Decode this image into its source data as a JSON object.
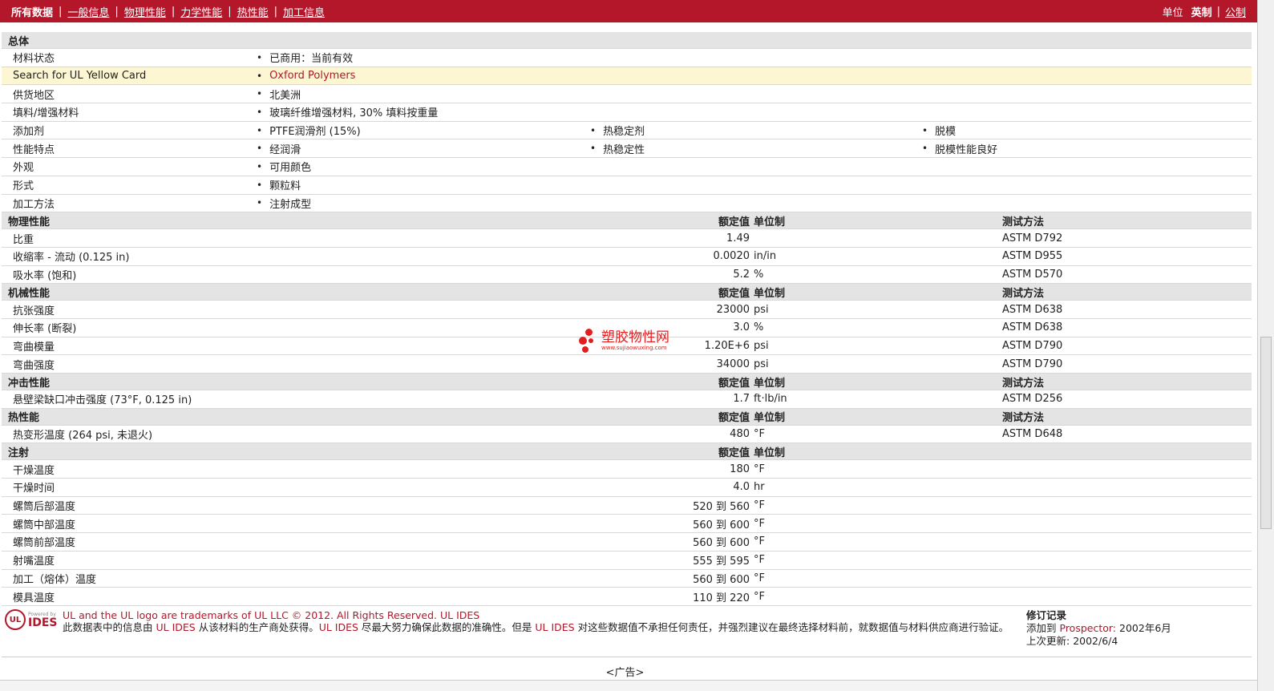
{
  "nav": {
    "items": [
      "所有数据",
      "一般信息",
      "物理性能",
      "力学性能",
      "热性能",
      "加工信息"
    ],
    "units_label": "单位",
    "units_current": "英制",
    "units_other": "公制"
  },
  "general": {
    "title": "总体",
    "rows": [
      {
        "label": "材料状态",
        "values": [
          "已商用：当前有效"
        ]
      },
      {
        "label": "Search for UL Yellow Card",
        "values": [
          "Oxford Polymers"
        ]
      },
      {
        "label": "供货地区",
        "values": [
          "北美洲"
        ]
      },
      {
        "label": "填料/增强材料",
        "values": [
          "玻璃纤维增强材料, 30% 填料按重量"
        ]
      },
      {
        "label": "添加剂",
        "values": [
          "PTFE润滑剂 (15%)",
          "热稳定剂",
          "脱模"
        ]
      },
      {
        "label": "性能特点",
        "values": [
          "经润滑",
          "热稳定性",
          "脱模性能良好"
        ]
      },
      {
        "label": "外观",
        "values": [
          "可用颜色"
        ]
      },
      {
        "label": "形式",
        "values": [
          "颗粒料"
        ]
      },
      {
        "label": "加工方法",
        "values": [
          "注射成型"
        ]
      }
    ]
  },
  "headers": {
    "nominal": "额定值",
    "unit": "单位制",
    "test": "测试方法"
  },
  "physical": {
    "title": "物理性能",
    "rows": [
      {
        "label": "比重",
        "value": "1.49",
        "unit": "",
        "test": "ASTM D792"
      },
      {
        "label": "收缩率 - 流动 (0.125 in)",
        "value": "0.0020",
        "unit": "in/in",
        "test": "ASTM D955"
      },
      {
        "label": "吸水率 (饱和)",
        "value": "5.2",
        "unit": "%",
        "test": "ASTM D570"
      }
    ]
  },
  "mechanical": {
    "title": "机械性能",
    "rows": [
      {
        "label": "抗张强度",
        "value": "23000",
        "unit": "psi",
        "test": "ASTM D638"
      },
      {
        "label": "伸长率 (断裂)",
        "value": "3.0",
        "unit": "%",
        "test": "ASTM D638"
      },
      {
        "label": "弯曲模量",
        "value": "1.20E+6",
        "unit": "psi",
        "test": "ASTM D790"
      },
      {
        "label": "弯曲强度",
        "value": "34000",
        "unit": "psi",
        "test": "ASTM D790"
      }
    ]
  },
  "impact": {
    "title": "冲击性能",
    "rows": [
      {
        "label": "悬壁梁缺口冲击强度 (73°F, 0.125 in)",
        "value": "1.7",
        "unit": "ft·lb/in",
        "test": "ASTM D256"
      }
    ]
  },
  "thermal": {
    "title": "热性能",
    "rows": [
      {
        "label": "热变形温度 (264 psi, 未退火)",
        "value": "480",
        "unit": "°F",
        "test": "ASTM D648"
      }
    ]
  },
  "injection": {
    "title": "注射",
    "rows": [
      {
        "label": "干燥温度",
        "value": "180",
        "unit": "°F"
      },
      {
        "label": "干燥时间",
        "value": "4.0",
        "unit": "hr"
      },
      {
        "label": "螺筒后部温度",
        "value": "520 到  560",
        "unit": "°F"
      },
      {
        "label": "螺筒中部温度",
        "value": "560 到  600",
        "unit": "°F"
      },
      {
        "label": "螺筒前部温度",
        "value": "560 到  600",
        "unit": "°F"
      },
      {
        "label": "射嘴温度",
        "value": "555 到  595",
        "unit": "°F"
      },
      {
        "label": "加工（熔体）温度",
        "value": "560 到  600",
        "unit": "°F"
      },
      {
        "label": "模具温度",
        "value": "110 到  220",
        "unit": "°F"
      }
    ]
  },
  "watermark": {
    "cn": "塑胶物性网",
    "url": "www.sujiaowuxing.com"
  },
  "footer": {
    "logo_powered": "Powered by",
    "logo_ul": "UL",
    "logo_ides": "IDES",
    "line1": "UL and the UL logo are trademarks of UL LLC © 2012. All Rights Reserved. UL IDES",
    "line2_a": "此数据表中的信息由 ",
    "line2_b": "UL IDES",
    "line2_c": " 从该材料的生产商处获得。",
    "line2_d": "UL IDES",
    "line2_e": " 尽最大努力确保此数据的准确性。但是 ",
    "line2_f": "UL IDES",
    "line2_g": " 对这些数据值不承担任何责任，并强烈建议在最终选择材料前，就数据值与材料供应商进行验证。",
    "rev_title": "修订记录",
    "rev_added_label": "添加到",
    "rev_added_src": "Prospector:",
    "rev_added_date": "2002年6月",
    "rev_updated_label": "上次更新:",
    "rev_updated_date": "2002/6/4",
    "ad": "<广告>"
  }
}
